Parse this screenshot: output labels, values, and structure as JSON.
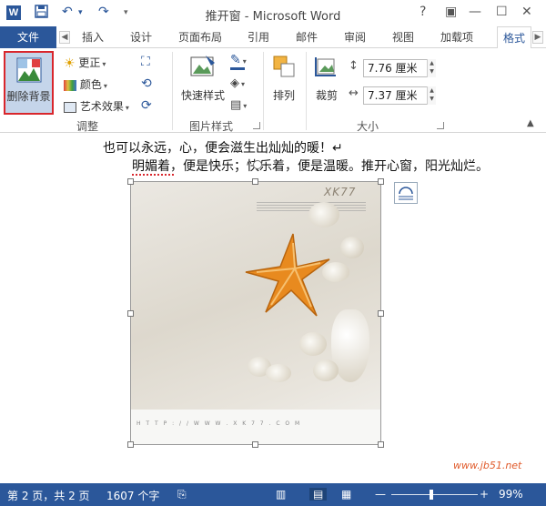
{
  "window": {
    "title": "推开窗 - Microsoft Word",
    "app_icon": "W",
    "controls": {
      "help": "?",
      "ribbon_options": "▣",
      "minimize": "—",
      "maximize": "☐",
      "close": "✕"
    }
  },
  "tabs": {
    "file": "文件",
    "items": [
      "插入",
      "设计",
      "页面布局",
      "引用",
      "邮件",
      "审阅",
      "视图",
      "加载项"
    ],
    "active": "格式"
  },
  "ribbon": {
    "adjust": {
      "remove_bg": "删除背景",
      "corrections": "更正",
      "color": "颜色",
      "artistic": "艺术效果",
      "label": "调整"
    },
    "picture_styles": {
      "quick_styles": "快速样式",
      "label": "图片样式"
    },
    "arrange": {
      "label": "排列"
    },
    "size": {
      "crop": "裁剪",
      "height": "7.76 厘米",
      "width": "7.37 厘米",
      "label": "大小"
    }
  },
  "document": {
    "line1": "也可以永远，心，便会滋生出灿灿的暖！↵",
    "line2": "明媚着，便是快乐；快乐着，便是温暖。推开心窗，阳光灿烂。",
    "picture": {
      "watermark": "XK77",
      "footer_text": "H T T P : / / W W W . X K 7 7 . C O M"
    }
  },
  "status": {
    "page": "第 2 页，共 2 页",
    "words": "1607 个字",
    "zoom": "99%",
    "site_watermark": "www.jb51.net"
  },
  "colors": {
    "accent": "#2b579a",
    "highlight_red": "#d9262c",
    "starfish": "#e88a1f"
  }
}
